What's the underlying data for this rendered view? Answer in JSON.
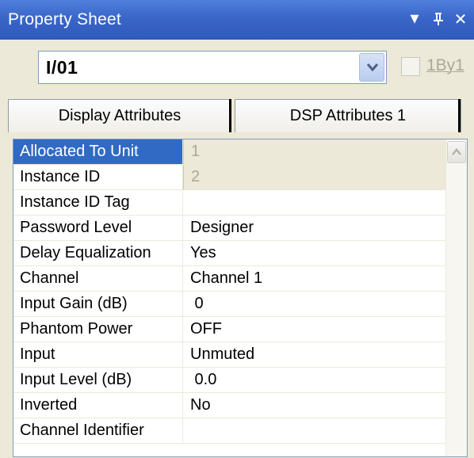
{
  "window": {
    "title": "Property Sheet",
    "dropdown_glyph": "▾",
    "pin_glyph": "ⴕ",
    "close_glyph": "✕"
  },
  "selector": {
    "value": "I/01",
    "checkbox_label": "1By1",
    "checkbox_checked": false,
    "checkbox_enabled": false
  },
  "tabs": [
    {
      "label": "Display Attributes",
      "active": false
    },
    {
      "label": "DSP Attributes 1",
      "active": true
    }
  ],
  "properties": [
    {
      "name": "Allocated To Unit",
      "value": "1",
      "selected": true,
      "readonly": true
    },
    {
      "name": "Instance ID",
      "value": "2",
      "selected": false,
      "readonly": true
    },
    {
      "name": "Instance ID Tag",
      "value": "",
      "selected": false,
      "readonly": false
    },
    {
      "name": "Password Level",
      "value": "Designer",
      "selected": false,
      "readonly": false
    },
    {
      "name": "Delay Equalization",
      "value": "Yes",
      "selected": false,
      "readonly": false
    },
    {
      "name": "Channel",
      "value": "Channel 1",
      "selected": false,
      "readonly": false
    },
    {
      "name": "Input Gain (dB)",
      "value": " 0",
      "selected": false,
      "readonly": false
    },
    {
      "name": "Phantom Power",
      "value": "OFF",
      "selected": false,
      "readonly": false
    },
    {
      "name": "Input",
      "value": "Unmuted",
      "selected": false,
      "readonly": false
    },
    {
      "name": "Input Level (dB)",
      "value": " 0.0",
      "selected": false,
      "readonly": false
    },
    {
      "name": "Inverted",
      "value": "No",
      "selected": false,
      "readonly": false
    },
    {
      "name": "Channel Identifier",
      "value": "",
      "selected": false,
      "readonly": false
    }
  ],
  "colors": {
    "title_bar": "#3a66c8",
    "selection": "#316ac5",
    "panel_bg": "#ece9d8",
    "disabled_text": "#aca899"
  }
}
